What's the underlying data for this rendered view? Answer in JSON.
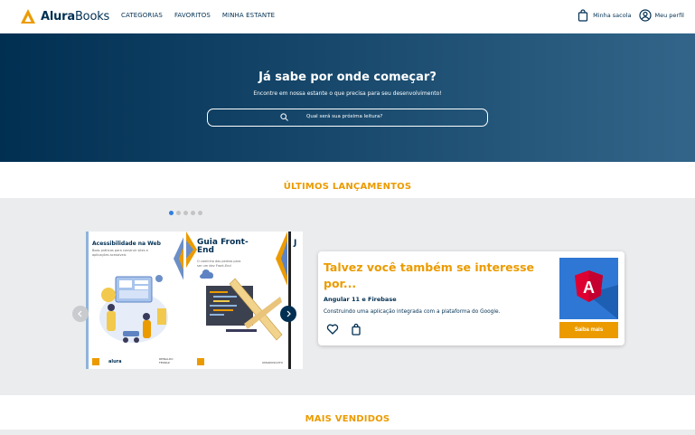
{
  "header": {
    "brand_bold": "Alura",
    "brand_light": "Books",
    "nav": [
      "CATEGORIAS",
      "FAVORITOS",
      "MINHA ESTANTE"
    ],
    "bag_label": "Minha sacola",
    "profile_label": "Meu perfil"
  },
  "hero": {
    "title": "Já sabe por onde começar?",
    "subtitle": "Encontre em nossa estante o que precisa para seu desenvolvimento!",
    "search_placeholder": "Qual será sua próxima leitura?"
  },
  "releases": {
    "title": "ÚLTIMOS LANÇAMENTOS",
    "carousel_pages": 5,
    "carousel_active": 1,
    "books": [
      {
        "title": "Acessibilidade na Web",
        "description": "Boas práticas para construir sites e aplicações acessíveis",
        "footer_brand": "alura",
        "author": "REINALDO FERRAZ"
      },
      {
        "title": "Guia Front-End",
        "description": "O caminho das pedras para ser um dev Front-End",
        "author": "OMARIOSOUTO"
      },
      {
        "title": "J"
      }
    ]
  },
  "recommendation": {
    "title": "Talvez você também se interesse por...",
    "book_title": "Angular 11 e Firebase",
    "book_description": "Construindo uma aplicação integrada com a plataforma do Google.",
    "button_label": "Saiba mais",
    "cover_letter": "A"
  },
  "bestsellers": {
    "title": "MAIS VENDIDOS"
  },
  "colors": {
    "navy": "#002f52",
    "accent_orange": "#eb9b00",
    "band_gray": "#ebecee",
    "active_dot": "#2f7fe0"
  }
}
